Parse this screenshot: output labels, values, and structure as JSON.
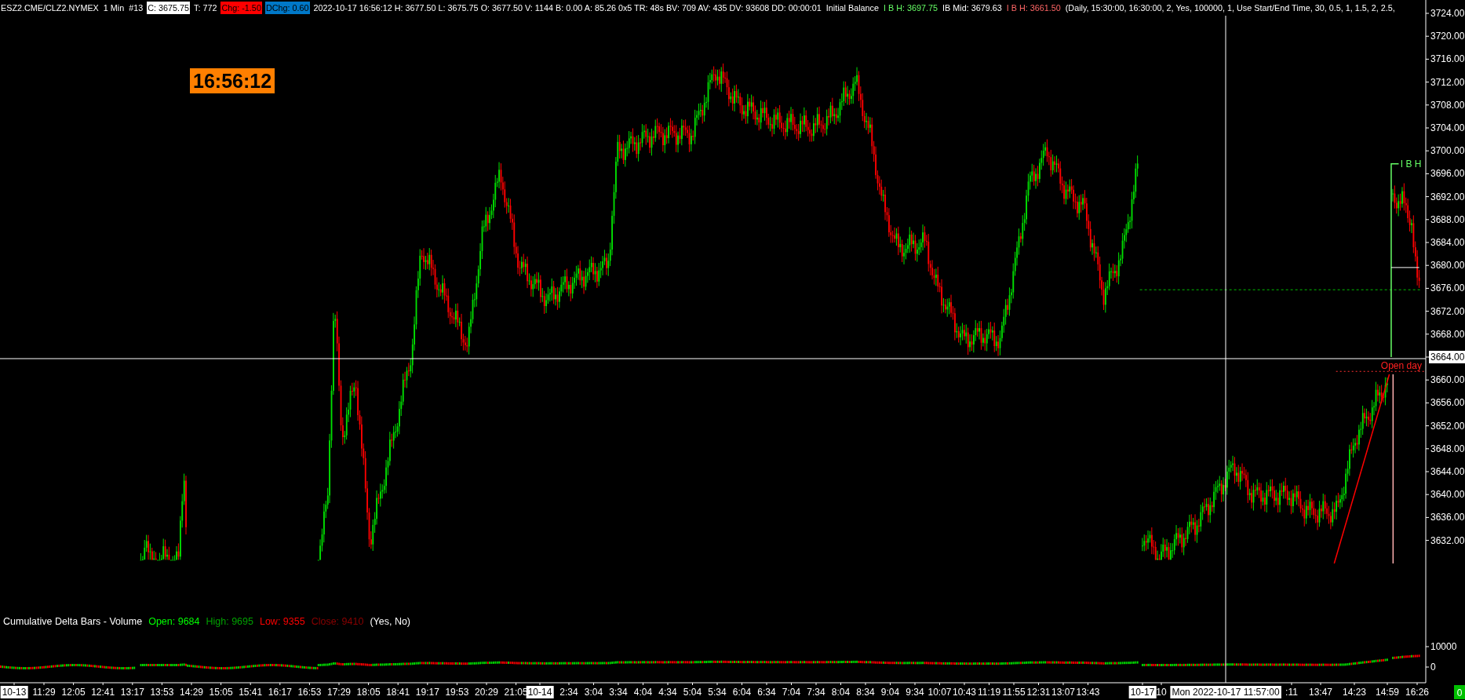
{
  "header": {
    "items": [
      {
        "kind": "text",
        "text": "ESZ2.CME/CLZ2.NYMEX",
        "color": "#ffffff"
      },
      {
        "kind": "text",
        "text": "1 Min",
        "color": "#ffffff"
      },
      {
        "kind": "text",
        "text": "#13",
        "color": "#ffffff"
      },
      {
        "kind": "box",
        "text": "C: 3675.75",
        "color": "#ffffff"
      },
      {
        "kind": "text",
        "text": "T: 772",
        "color": "#ffffff"
      },
      {
        "kind": "box",
        "text": "Chg: -1.50",
        "color": "#ff0000"
      },
      {
        "kind": "box",
        "text": "DChg: 0.60",
        "color": "#0078c8"
      },
      {
        "kind": "text",
        "text": "2022-10-17 16:56:12 H: 3677.50 L: 3675.75 O: 3677.50 V: 1144 B: 0.00 A: 85.26 0x5 TR: 48s BV: 709 AV: 435 DV: 93608 DD: 00:00:01",
        "color": "#ffffff"
      },
      {
        "kind": "text",
        "text": "Initial Balance",
        "color": "#ffffff"
      },
      {
        "kind": "text",
        "text": "I B H: 3697.75",
        "color": "#66ff66"
      },
      {
        "kind": "text",
        "text": "IB Mid: 3679.63",
        "color": "#ffffff"
      },
      {
        "kind": "text",
        "text": "I B H: 3661.50",
        "color": "#ff6666"
      },
      {
        "kind": "text",
        "text": "(Daily, 15:30:00, 16:30:00, 2, Yes, 100000, 1, Use Start/End Time, 30, 0.5, 1, 1.5, 2, 2.5,",
        "color": "#ffffff"
      }
    ]
  },
  "clock": {
    "text": "16:56:12"
  },
  "ib_high_label": "I B H",
  "open_day_label": "Open day",
  "price_axis": {
    "labels": [
      {
        "text": "3724.00",
        "selected": false
      },
      {
        "text": "3720.00",
        "selected": false
      },
      {
        "text": "3716.00",
        "selected": false
      },
      {
        "text": "3712.00",
        "selected": false
      },
      {
        "text": "3708.00",
        "selected": false
      },
      {
        "text": "3704.00",
        "selected": false
      },
      {
        "text": "3700.00",
        "selected": false
      },
      {
        "text": "3696.00",
        "selected": false
      },
      {
        "text": "3692.00",
        "selected": false
      },
      {
        "text": "3688.00",
        "selected": false
      },
      {
        "text": "3684.00",
        "selected": false
      },
      {
        "text": "3680.00",
        "selected": false
      },
      {
        "text": "3676.00",
        "selected": false
      },
      {
        "text": "3672.00",
        "selected": false
      },
      {
        "text": "3668.00",
        "selected": false
      },
      {
        "text": "3664.00",
        "selected": true
      },
      {
        "text": "3660.00",
        "selected": false
      },
      {
        "text": "3656.00",
        "selected": false
      },
      {
        "text": "3652.00",
        "selected": false
      },
      {
        "text": "3648.00",
        "selected": false
      },
      {
        "text": "3644.00",
        "selected": false
      },
      {
        "text": "3640.00",
        "selected": false
      },
      {
        "text": "3636.00",
        "selected": false
      },
      {
        "text": "3632.00",
        "selected": false
      }
    ]
  },
  "crosshair": {
    "time_label": "Mon 2022-10-17  11:57:00"
  },
  "indicator": {
    "items": [
      {
        "text": "Cumulative Delta Bars - Volume",
        "color": "#ffffff"
      },
      {
        "text": "Open: 9684",
        "color": "#00ff00"
      },
      {
        "text": "High: 9695",
        "color": "#00a000"
      },
      {
        "text": "Low: 9355",
        "color": "#ff0000"
      },
      {
        "text": "Close: 9410",
        "color": "#8b0000"
      },
      {
        "text": "(Yes, No)",
        "color": "#ffffff"
      }
    ]
  },
  "volume_axis": {
    "labels": [
      "10000",
      "0"
    ]
  },
  "time_axis": {
    "labels": [
      {
        "kind": "date",
        "text": "10-13"
      },
      {
        "kind": "time",
        "text": "11:29"
      },
      {
        "kind": "time",
        "text": "12:05"
      },
      {
        "kind": "time",
        "text": "12:41"
      },
      {
        "kind": "time",
        "text": "13:17"
      },
      {
        "kind": "time",
        "text": "13:53"
      },
      {
        "kind": "time",
        "text": "14:29"
      },
      {
        "kind": "time",
        "text": "15:05"
      },
      {
        "kind": "time",
        "text": "15:41"
      },
      {
        "kind": "time",
        "text": "16:17"
      },
      {
        "kind": "time",
        "text": "16:53"
      },
      {
        "kind": "time",
        "text": "17:29"
      },
      {
        "kind": "time",
        "text": "18:05"
      },
      {
        "kind": "time",
        "text": "18:41"
      },
      {
        "kind": "time",
        "text": "19:17"
      },
      {
        "kind": "time",
        "text": "19:53"
      },
      {
        "kind": "time",
        "text": "20:29"
      },
      {
        "kind": "time",
        "text": "21:05"
      },
      {
        "kind": "date",
        "text": "10-14"
      },
      {
        "kind": "time",
        "text": "2:34"
      },
      {
        "kind": "time",
        "text": "3:04"
      },
      {
        "kind": "time",
        "text": "3:34"
      },
      {
        "kind": "time",
        "text": "4:04"
      },
      {
        "kind": "time",
        "text": "4:34"
      },
      {
        "kind": "time",
        "text": "5:04"
      },
      {
        "kind": "time",
        "text": "5:34"
      },
      {
        "kind": "time",
        "text": "6:04"
      },
      {
        "kind": "time",
        "text": "6:34"
      },
      {
        "kind": "time",
        "text": "7:04"
      },
      {
        "kind": "time",
        "text": "7:34"
      },
      {
        "kind": "time",
        "text": "8:04"
      },
      {
        "kind": "time",
        "text": "8:34"
      },
      {
        "kind": "time",
        "text": "9:04"
      },
      {
        "kind": "time",
        "text": "9:34"
      },
      {
        "kind": "time",
        "text": "10:07"
      },
      {
        "kind": "time",
        "text": "10:43"
      },
      {
        "kind": "time",
        "text": "11:19"
      },
      {
        "kind": "time",
        "text": "11:55"
      },
      {
        "kind": "time",
        "text": "12:31"
      },
      {
        "kind": "time",
        "text": "13:07"
      },
      {
        "kind": "time",
        "text": "13:43"
      },
      {
        "kind": "date",
        "text": "10-17"
      },
      {
        "kind": "time",
        "text": "10"
      },
      {
        "kind": "time",
        "text": ":11"
      },
      {
        "kind": "time",
        "text": "13:47"
      },
      {
        "kind": "time",
        "text": "14:23"
      },
      {
        "kind": "time",
        "text": "14:59"
      },
      {
        "kind": "time",
        "text": "16:26"
      }
    ]
  },
  "status_box": {
    "text": "0"
  }
}
